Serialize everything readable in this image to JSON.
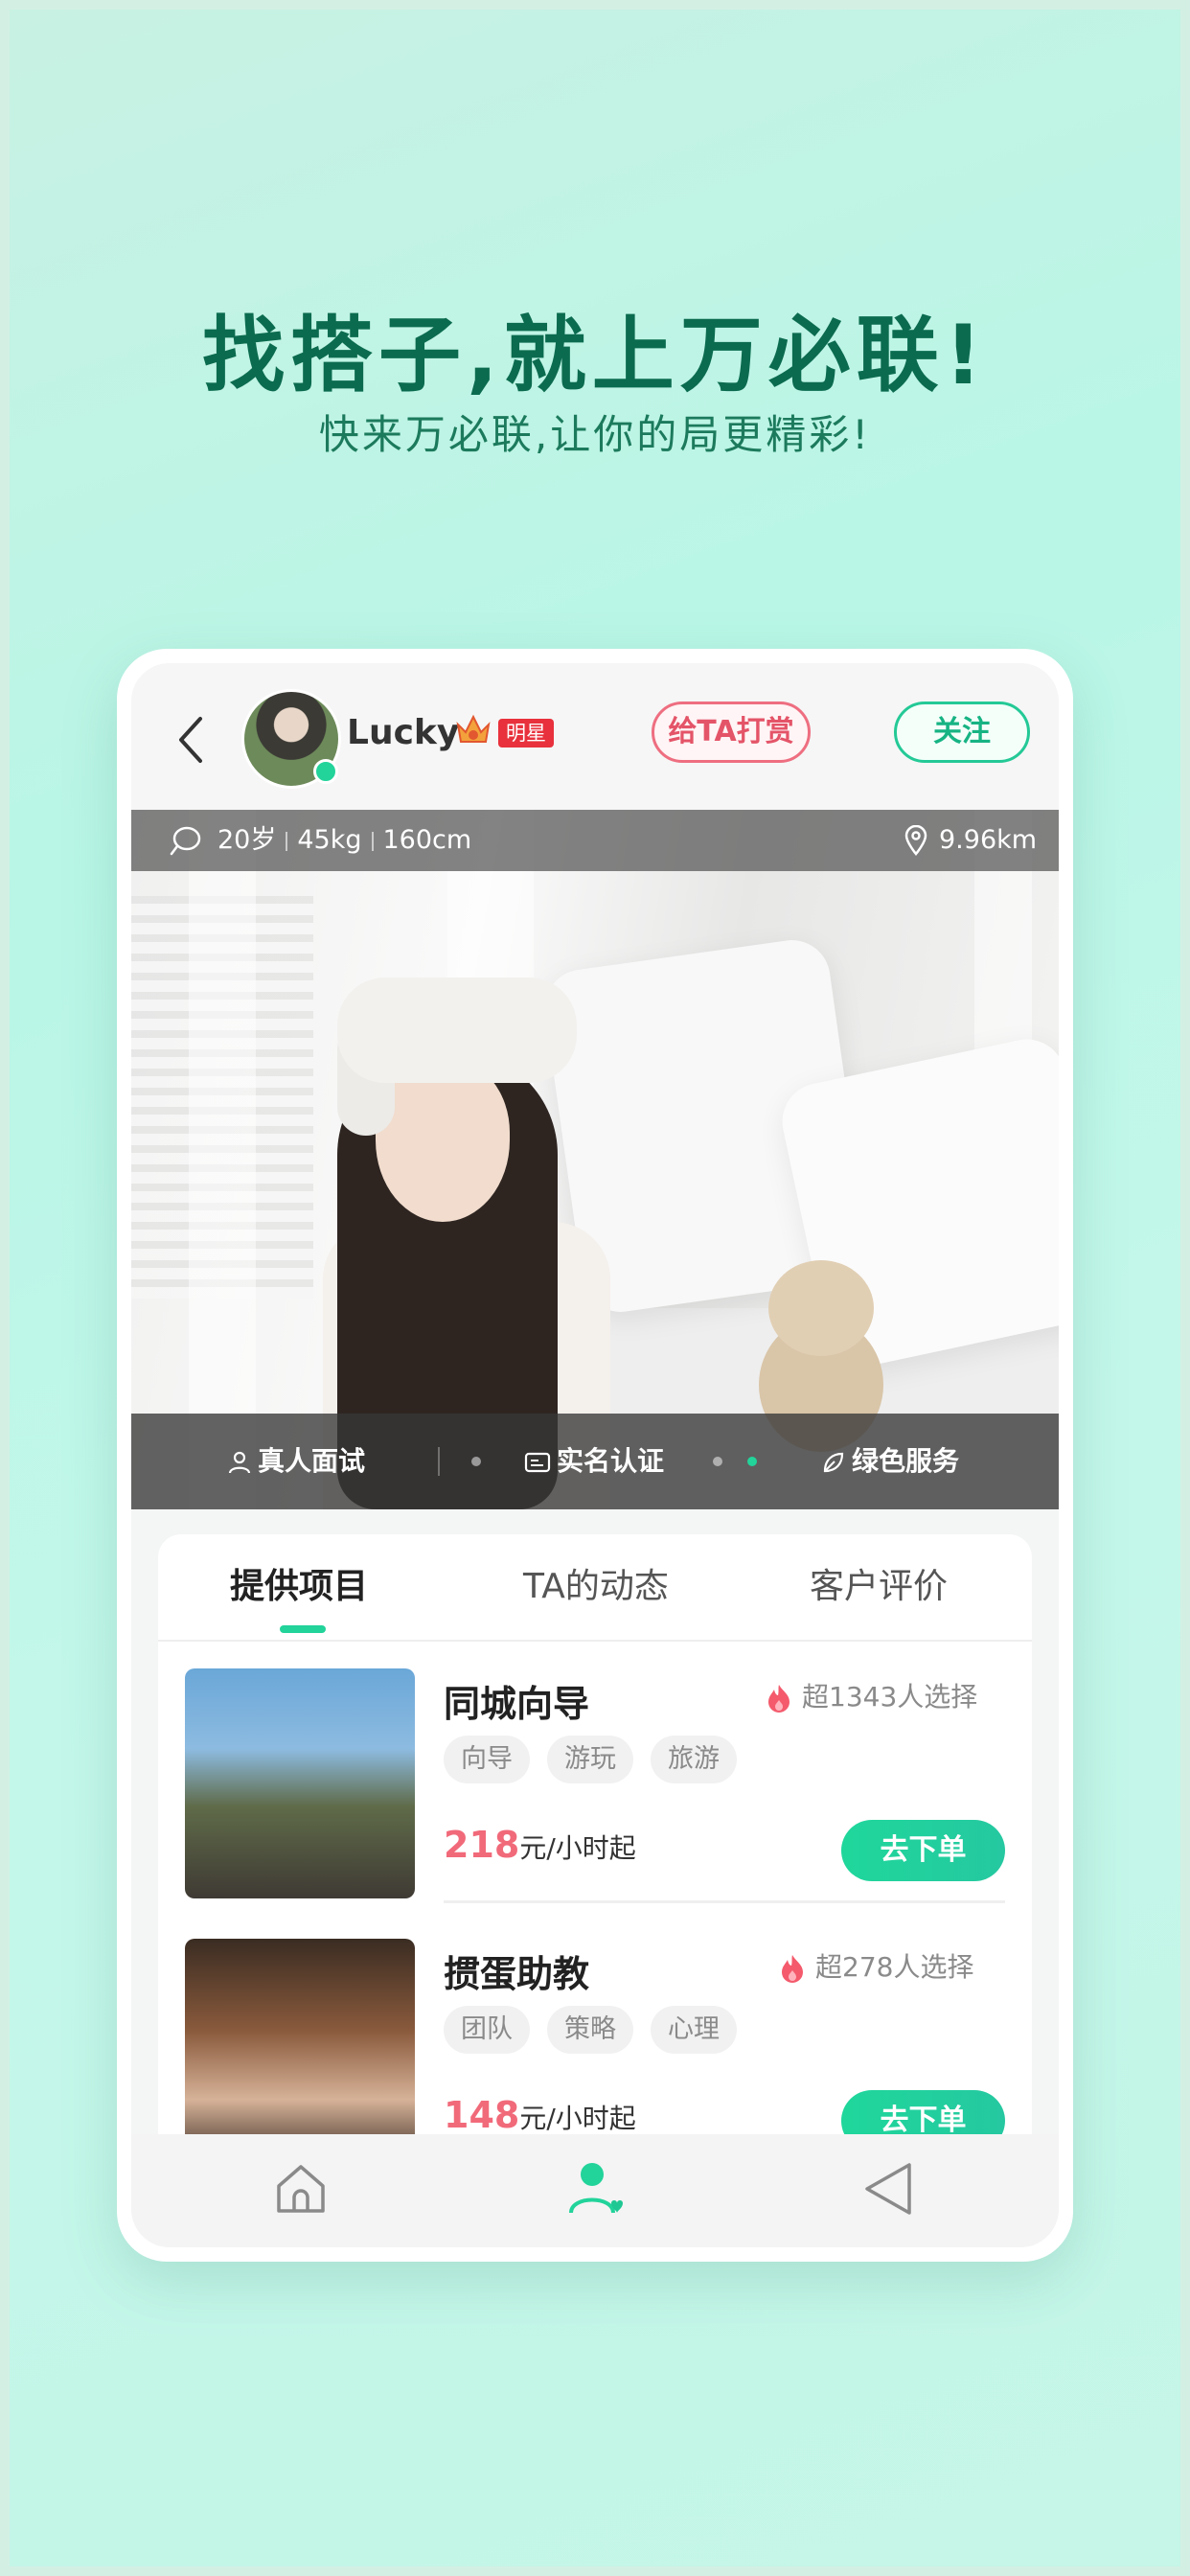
{
  "hero": {
    "title": "找搭子,就上万必联!",
    "subtitle": "快来万必联,让你的局更精彩!"
  },
  "profile": {
    "name": "Lucky",
    "star_badge": "明星",
    "tip_label": "给TA打赏",
    "follow_label": "关注",
    "age": "20岁",
    "weight": "45kg",
    "height": "160cm",
    "distance": "9.96km"
  },
  "badges": {
    "real_person": "真人面试",
    "real_name": "实名认证",
    "green_service": "绿色服务"
  },
  "tabs": [
    {
      "label": "提供项目"
    },
    {
      "label": "TA的动态"
    },
    {
      "label": "客户评价"
    }
  ],
  "services": [
    {
      "title": "同城向导",
      "hot": "超1343人选择",
      "tags": [
        "向导",
        "游玩",
        "旅游"
      ],
      "price": "218",
      "unit": "元/小时起",
      "order_label": "去下单"
    },
    {
      "title": "掼蛋助教",
      "hot": "超278人选择",
      "tags": [
        "团队",
        "策略",
        "心理"
      ],
      "price": "148",
      "unit": "元/小时起",
      "order_label": "去下单"
    }
  ],
  "nav": [
    "home-icon",
    "profile-icon",
    "back-triangle-icon"
  ],
  "colors": {
    "brand_green": "#22d39a",
    "title_green": "#0b6b4e",
    "price_red": "#f16a7a",
    "tip_pink": "#e45468"
  }
}
